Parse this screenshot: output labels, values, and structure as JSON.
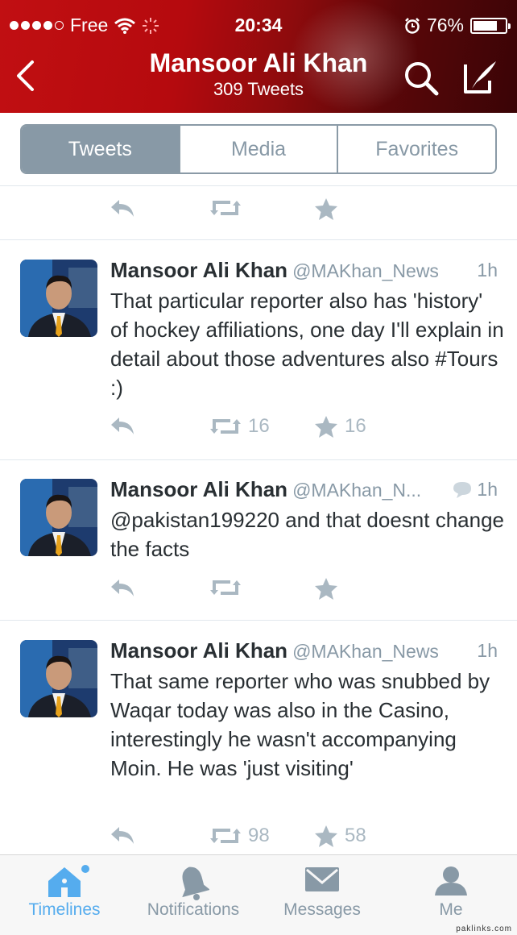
{
  "status_bar": {
    "carrier": "Free",
    "time": "20:34",
    "battery": "76%",
    "battery_level": 0.76,
    "signal_bars_filled": 4
  },
  "nav": {
    "title": "Mansoor Ali Khan",
    "subtitle": "309 Tweets",
    "back_icon": "chevron-left-icon",
    "search_icon": "search-icon",
    "compose_icon": "compose-icon"
  },
  "segments": [
    {
      "label": "Tweets",
      "active": true
    },
    {
      "label": "Media",
      "active": false
    },
    {
      "label": "Favorites",
      "active": false
    }
  ],
  "tweets": [
    {
      "name": "Mansoor Ali Khan",
      "handle": "@MAKhan_News",
      "time": "1h",
      "text": "That particular reporter also has 'history' of hockey affiliations, one day I'll explain in detail about those adventures also #Tours :)",
      "retweets": "16",
      "favorites": "16"
    },
    {
      "name": "Mansoor Ali Khan",
      "handle": "@MAKhan_N...",
      "time": "1h",
      "text": "@pakistan199220 and that doesnt change the facts",
      "retweets": "",
      "favorites": ""
    },
    {
      "name": "Mansoor Ali Khan",
      "handle": "@MAKhan_News",
      "time": "1h",
      "text": "That same reporter who was snubbed by Waqar today was also in the Casino, interestingly he wasn't accompanying Moin. He was 'just visiting'",
      "retweets": "98",
      "favorites": "58"
    }
  ],
  "tabbar": [
    {
      "label": "Timelines",
      "icon": "home-icon",
      "active": true
    },
    {
      "label": "Notifications",
      "icon": "bell-icon",
      "active": false
    },
    {
      "label": "Messages",
      "icon": "envelope-icon",
      "active": false
    },
    {
      "label": "Me",
      "icon": "person-icon",
      "active": false
    }
  ],
  "watermark": "paklinks.com",
  "colors": {
    "header": "#c10f12",
    "accent": "#55acee",
    "muted": "#8899a6",
    "icon_muted": "#aab8c2"
  }
}
